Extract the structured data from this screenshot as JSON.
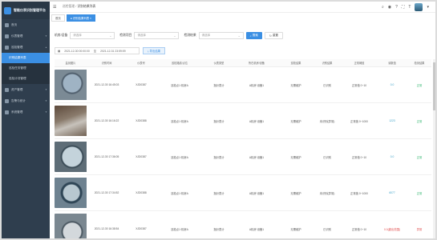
{
  "app": {
    "title": "智能仪表识别管理平台"
  },
  "sidebar": {
    "items": [
      {
        "label": "首页",
        "icon": "home-icon"
      },
      {
        "label": "仪表管理",
        "icon": "meter-icon"
      },
      {
        "label": "巡检管理",
        "icon": "inspect-icon"
      }
    ],
    "sub_items": [
      {
        "label": "识别结果列表",
        "active": true
      },
      {
        "label": "巡检任务管理",
        "active": false
      },
      {
        "label": "巡检计划管理",
        "active": false
      }
    ],
    "items_after": [
      {
        "label": "资产管理",
        "icon": "asset-icon"
      },
      {
        "label": "告警与统计",
        "icon": "alarm-icon"
      },
      {
        "label": "系统管理",
        "icon": "settings-icon"
      }
    ]
  },
  "topbar": {
    "crumb_home": "巡检管理",
    "crumb_sep": "/",
    "crumb_current": "识别结果列表"
  },
  "tabs": [
    {
      "label": "首页",
      "active": false
    },
    {
      "label": "● 识别结果列表  ×",
      "active": true
    }
  ],
  "filters": {
    "point_label": "机房/设备",
    "point_value": "请选择",
    "result_label": "检测项目",
    "result_placeholder": "请选择",
    "status_label": "检测结果",
    "status_placeholder": "请选择",
    "search_btn": "搜索",
    "reset_btn": "重置"
  },
  "daterange": {
    "start": "2021-12-30 00:00:00",
    "sep": "至",
    "end": "2021-12-31 23:59:59"
  },
  "export_btn": "导出结果",
  "table": {
    "headers": [
      "监测图片",
      "识别时间",
      "仪表号",
      "巡检路线/点位",
      "仪表类型",
      "所在机房/设备",
      "巡检结果",
      "识别结果",
      "正常阈值",
      "读数值",
      "检测结果"
    ],
    "rows": [
      {
        "time": "2021-12-30 16:45:03",
        "code": "XJD0387",
        "point": "巡检点1·机房A",
        "type": "指针表计",
        "room": "A机房·设备1",
        "result": "无需维护",
        "recog": "已识别",
        "range": "正常值 0~10",
        "value": "0.0",
        "value_state": "ok",
        "status": "正常",
        "status_state": "ok"
      },
      {
        "time": "2021-12-30 16:16:22",
        "code": "XJD0388",
        "point": "巡检点1·机房A",
        "type": "指针表计",
        "room": "A机房·设备1",
        "result": "无需维护",
        "recog": "未识别(异常)",
        "range": "正常值 0~1000",
        "value": "1223",
        "value_state": "ok",
        "status": "正常",
        "status_state": "ok"
      },
      {
        "time": "2021-12-30 17:36:05",
        "code": "XJD0387",
        "point": "巡检点1·机房A",
        "type": "指针表计",
        "room": "A机房·设备1",
        "result": "无需维护",
        "recog": "已识别",
        "range": "正常值 0~10",
        "value": "0.0",
        "value_state": "ok",
        "status": "正常",
        "status_state": "ok"
      },
      {
        "time": "2021-12-30 17:34:52",
        "code": "XJD0388",
        "point": "巡检点1·机房A",
        "type": "指针表计",
        "room": "A机房·设备1",
        "result": "无需维护",
        "recog": "未识别(异常)",
        "range": "正常值 0~1000",
        "value": "6077",
        "value_state": "ok",
        "status": "正常",
        "status_state": "ok"
      },
      {
        "time": "2021-12-30 16:38:54",
        "code": "XJD0387",
        "point": "巡检点1·机房A",
        "type": "指针表计",
        "room": "A机房·设备1",
        "result": "无需维护",
        "recog": "已识别",
        "range": "正常值 0~10",
        "value": "0.0(超出范围)",
        "value_state": "bad",
        "status": "异常",
        "status_state": "bad"
      }
    ]
  },
  "colors": {
    "sidebar": "#2f3e4e",
    "accent": "#3b8fe3",
    "ok": "#2bb36b",
    "bad": "#e14b4b"
  }
}
